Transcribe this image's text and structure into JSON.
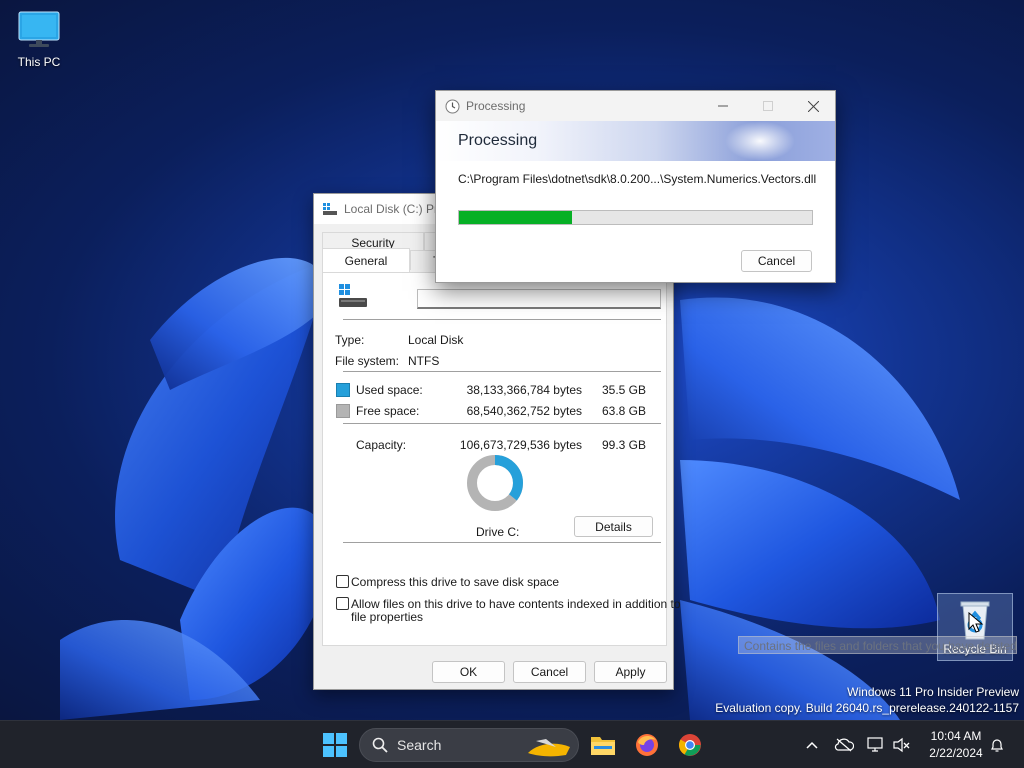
{
  "desktop": {
    "icons": [
      {
        "label": "This PC"
      },
      {
        "label": "Recycle Bin"
      }
    ],
    "recycle_tooltip": "Contains the files and folders that you have deleted.",
    "watermark_line1": "Windows 11 Pro Insider Preview",
    "watermark_line2": "Evaluation copy. Build 26040.rs_prerelease.240122-1157"
  },
  "properties": {
    "title": "Local Disk (C:) Pro",
    "tabs": {
      "security": "Security",
      "general": "General",
      "tools_partial": "T"
    },
    "name_value": "",
    "type_label": "Type:",
    "type_value": "Local Disk",
    "fs_label": "File system:",
    "fs_value": "NTFS",
    "used_label": "Used space:",
    "used_bytes": "38,133,366,784 bytes",
    "used_gb": "35.5 GB",
    "free_label": "Free space:",
    "free_bytes": "68,540,362,752 bytes",
    "free_gb": "63.8 GB",
    "capacity_label": "Capacity:",
    "capacity_bytes": "106,673,729,536 bytes",
    "capacity_gb": "99.3 GB",
    "used_fraction": 0.357,
    "drive_label": "Drive C:",
    "details_button": "Details",
    "compress_label": "Compress this drive to save disk space",
    "index_label_line1": "Allow files on this drive to have contents indexed in addition to",
    "index_label_line2": "file properties",
    "ok_button": "OK",
    "cancel_button": "Cancel",
    "apply_button": "Apply",
    "colors": {
      "used": "#26a0da",
      "free": "#b4b4b4"
    }
  },
  "processing": {
    "window_title": "Processing",
    "heading": "Processing",
    "path": "C:\\Program Files\\dotnet\\sdk\\8.0.200...\\System.Numerics.Vectors.dll",
    "progress_fraction": 0.32,
    "cancel_button": "Cancel",
    "progress_color": "#06b025"
  },
  "taskbar": {
    "search_placeholder": "Search",
    "time": "10:04 AM",
    "date": "2/22/2024"
  }
}
